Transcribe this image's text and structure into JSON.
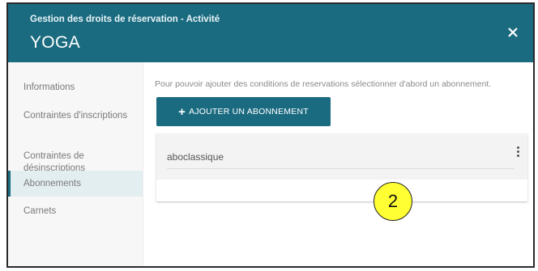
{
  "header": {
    "subtitle": "Gestion des droits de réservation - Activité",
    "title": "YOGA",
    "close_icon": "close-icon",
    "background": "#1b6b80"
  },
  "sidebar": {
    "items": [
      {
        "label": "Informations"
      },
      {
        "label": "Contraintes d'inscriptions"
      },
      {
        "label": "Contraintes de\ndésinscriptions"
      },
      {
        "label": "Abonnements",
        "active": true
      },
      {
        "label": "Carnets"
      }
    ]
  },
  "main": {
    "hint": "Pour pouvoir ajouter des conditions de reservations sélectionner d'abord un abonnement.",
    "add_button": {
      "icon": "plus-icon",
      "label": "AJOUTER UN ABONNEMENT"
    },
    "subscriptions": [
      {
        "name": "aboclassique",
        "menu_icon": "kebab-menu-icon"
      }
    ]
  },
  "annotation": {
    "step": "2",
    "color": "#ffff33"
  }
}
